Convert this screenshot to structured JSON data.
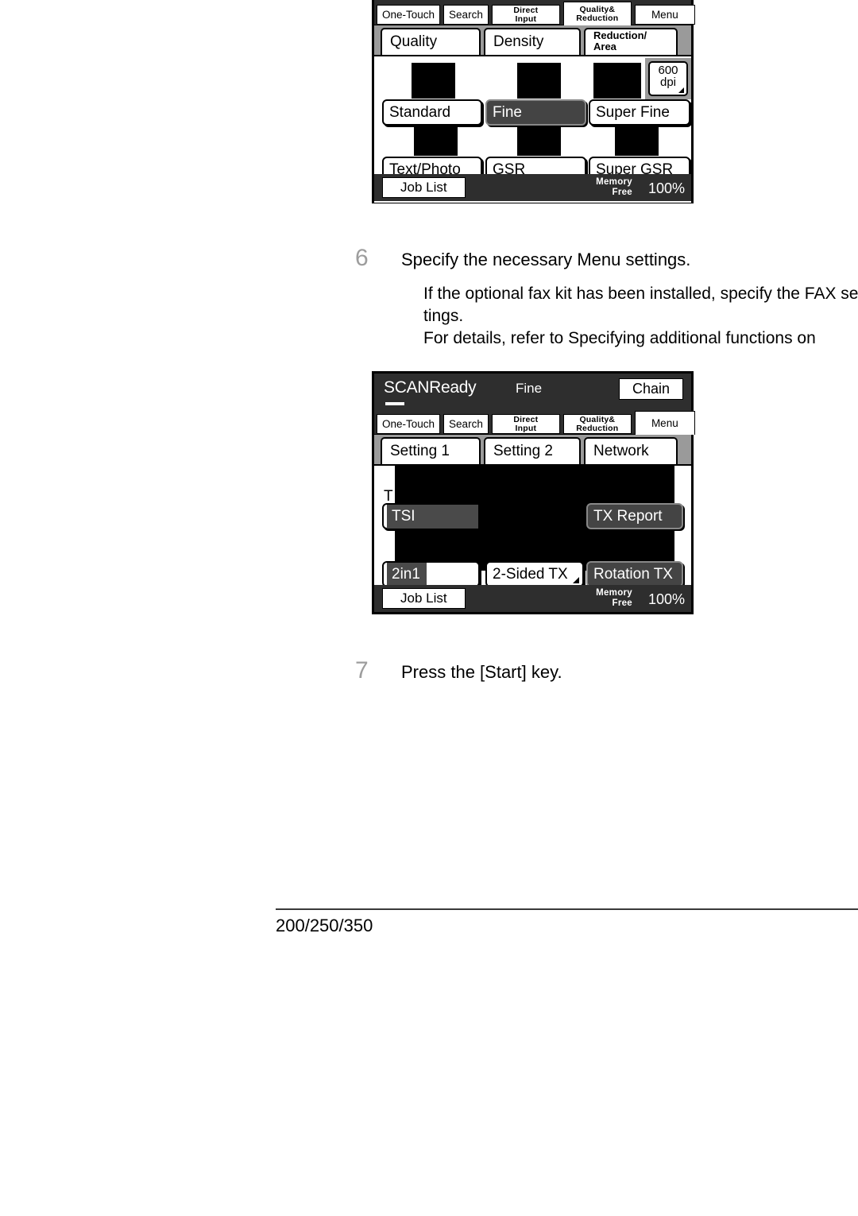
{
  "document": {
    "footer_label": "200/250/350"
  },
  "steps": [
    {
      "number": "6",
      "title": "Specify the necessary Menu settings.",
      "lines": [
        "If the optional fax kit has been installed, specify the FAX set-",
        "tings.",
        "For details, refer to  Specifying additional functions  on"
      ]
    },
    {
      "number": "7",
      "title": "Press the [Start] key.",
      "lines": []
    }
  ],
  "panel_quality": {
    "function_tabs": [
      {
        "label": "One-Touch",
        "lines": [
          "One-Touch"
        ],
        "active": false
      },
      {
        "label": "Search",
        "lines": [
          "Search"
        ],
        "active": false
      },
      {
        "label": "Direct Input",
        "lines": [
          "Direct",
          "Input"
        ],
        "active": false
      },
      {
        "label": "Quality& Reduction",
        "lines": [
          "Quality&",
          "Reduction"
        ],
        "active": true
      },
      {
        "label": "Menu",
        "lines": [
          "Menu"
        ],
        "active": false
      }
    ],
    "sub_tabs": [
      {
        "label": "Quality",
        "lines": [
          "Quality"
        ],
        "active": true
      },
      {
        "label": "Density",
        "lines": [
          "Density"
        ],
        "active": false
      },
      {
        "label": "Reduction/Area",
        "lines": [
          "Reduction/",
          "Area"
        ],
        "active": false
      }
    ],
    "options": [
      {
        "label": "Standard",
        "selected": false
      },
      {
        "label": "Fine",
        "selected": true
      },
      {
        "label": "Super Fine",
        "selected": false
      },
      {
        "label": "Text/Photo",
        "selected": false
      },
      {
        "label": "GSR",
        "selected": false
      },
      {
        "label": "Super GSR",
        "selected": false
      }
    ],
    "dpi_button": {
      "line1": "600",
      "line2": "dpi"
    },
    "footer": {
      "job_list": "Job List",
      "memory_label_1": "Memory",
      "memory_label_2": "Free",
      "memory_value": "100%"
    }
  },
  "panel_menu": {
    "status": {
      "ready": "SCANReady",
      "mode": "Fine",
      "chain": "Chain"
    },
    "function_tabs": [
      {
        "label": "One-Touch",
        "lines": [
          "One-Touch"
        ],
        "active": false
      },
      {
        "label": "Search",
        "lines": [
          "Search"
        ],
        "active": false
      },
      {
        "label": "Direct Input",
        "lines": [
          "Direct",
          "Input"
        ],
        "active": false
      },
      {
        "label": "Quality& Reduction",
        "lines": [
          "Quality&",
          "Reduction"
        ],
        "active": false
      },
      {
        "label": "Menu",
        "lines": [
          "Menu"
        ],
        "active": true
      }
    ],
    "sub_tabs": [
      {
        "label": "Setting 1",
        "lines": [
          "Setting 1"
        ],
        "active": true
      },
      {
        "label": "Setting 2",
        "lines": [
          "Setting 2"
        ],
        "active": false
      },
      {
        "label": "Network",
        "lines": [
          "Network"
        ],
        "active": false
      }
    ],
    "partial_label": "T",
    "options": [
      {
        "label": "TSI",
        "selected": true
      },
      {
        "label": "TX Report",
        "selected": true
      },
      {
        "label": "2in1",
        "selected": true
      },
      {
        "label": "2-Sided TX",
        "selected": false
      },
      {
        "label": "Rotation TX",
        "selected": true
      }
    ],
    "footer": {
      "job_list": "Job List",
      "memory_label_1": "Memory",
      "memory_label_2": "Free",
      "memory_value": "100%"
    }
  },
  "colors": {
    "lcd_dark": "#2e2e2e",
    "lcd_grey": "#9a9a9a",
    "selected_fill": "#444444",
    "step_number": "#9d9d9d"
  }
}
